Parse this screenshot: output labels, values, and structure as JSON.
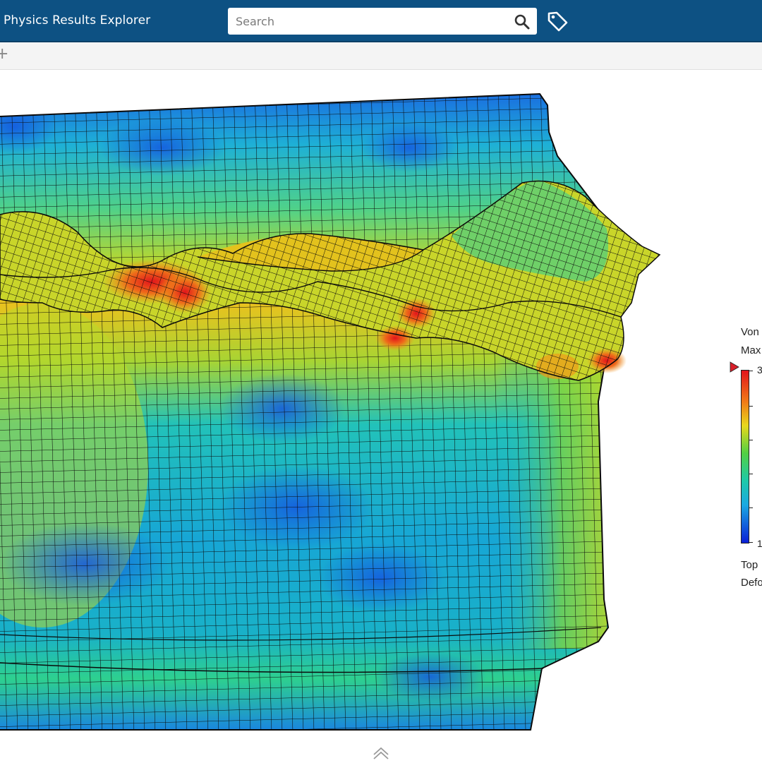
{
  "app": {
    "title": "Physics Results Explorer"
  },
  "search": {
    "placeholder": "Search"
  },
  "icons": {
    "search": "search-icon",
    "tag": "tag-icon",
    "add": "plus-icon",
    "collapse": "chevron-up-icon",
    "max_marker": "max-marker-icon"
  },
  "toolbar": {
    "add_symbol": "+"
  },
  "legend": {
    "line1": "Von",
    "line2": "Max",
    "max_label": "3",
    "min_label": "1",
    "line3": "Top",
    "line4": "Defo"
  },
  "colors": {
    "header": "#0d5183",
    "stress_max": "#e2151b",
    "stress_min": "#0a1fd6",
    "marker": "#d8202a"
  }
}
